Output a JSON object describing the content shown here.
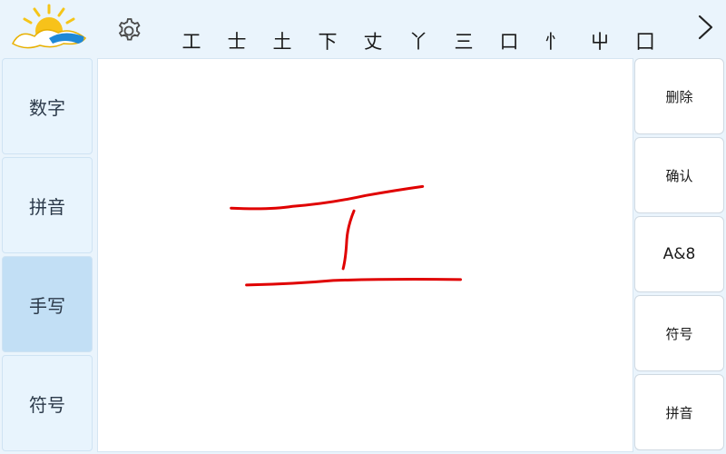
{
  "topbar": {
    "logo_icon": "sun-cloud-logo-icon",
    "settings_icon": "gear-icon",
    "next_icon": "chevron-right-icon",
    "candidates": [
      "工",
      "士",
      "土",
      "下",
      "丈",
      "丫",
      "三",
      "口",
      "忄",
      "屮",
      "囗"
    ]
  },
  "left_modes": [
    {
      "label": "数字",
      "active": false
    },
    {
      "label": "拼音",
      "active": false
    },
    {
      "label": "手写",
      "active": true
    },
    {
      "label": "符号",
      "active": false
    }
  ],
  "right_actions": {
    "delete": "删除",
    "confirm": "确认",
    "alnum": "A&8",
    "symbol": "符号",
    "pinyin": "拼音"
  },
  "canvas": {
    "ink_color": "#e00000"
  },
  "colors": {
    "background": "#eaf4fc",
    "active_mode": "#c2dff5"
  }
}
